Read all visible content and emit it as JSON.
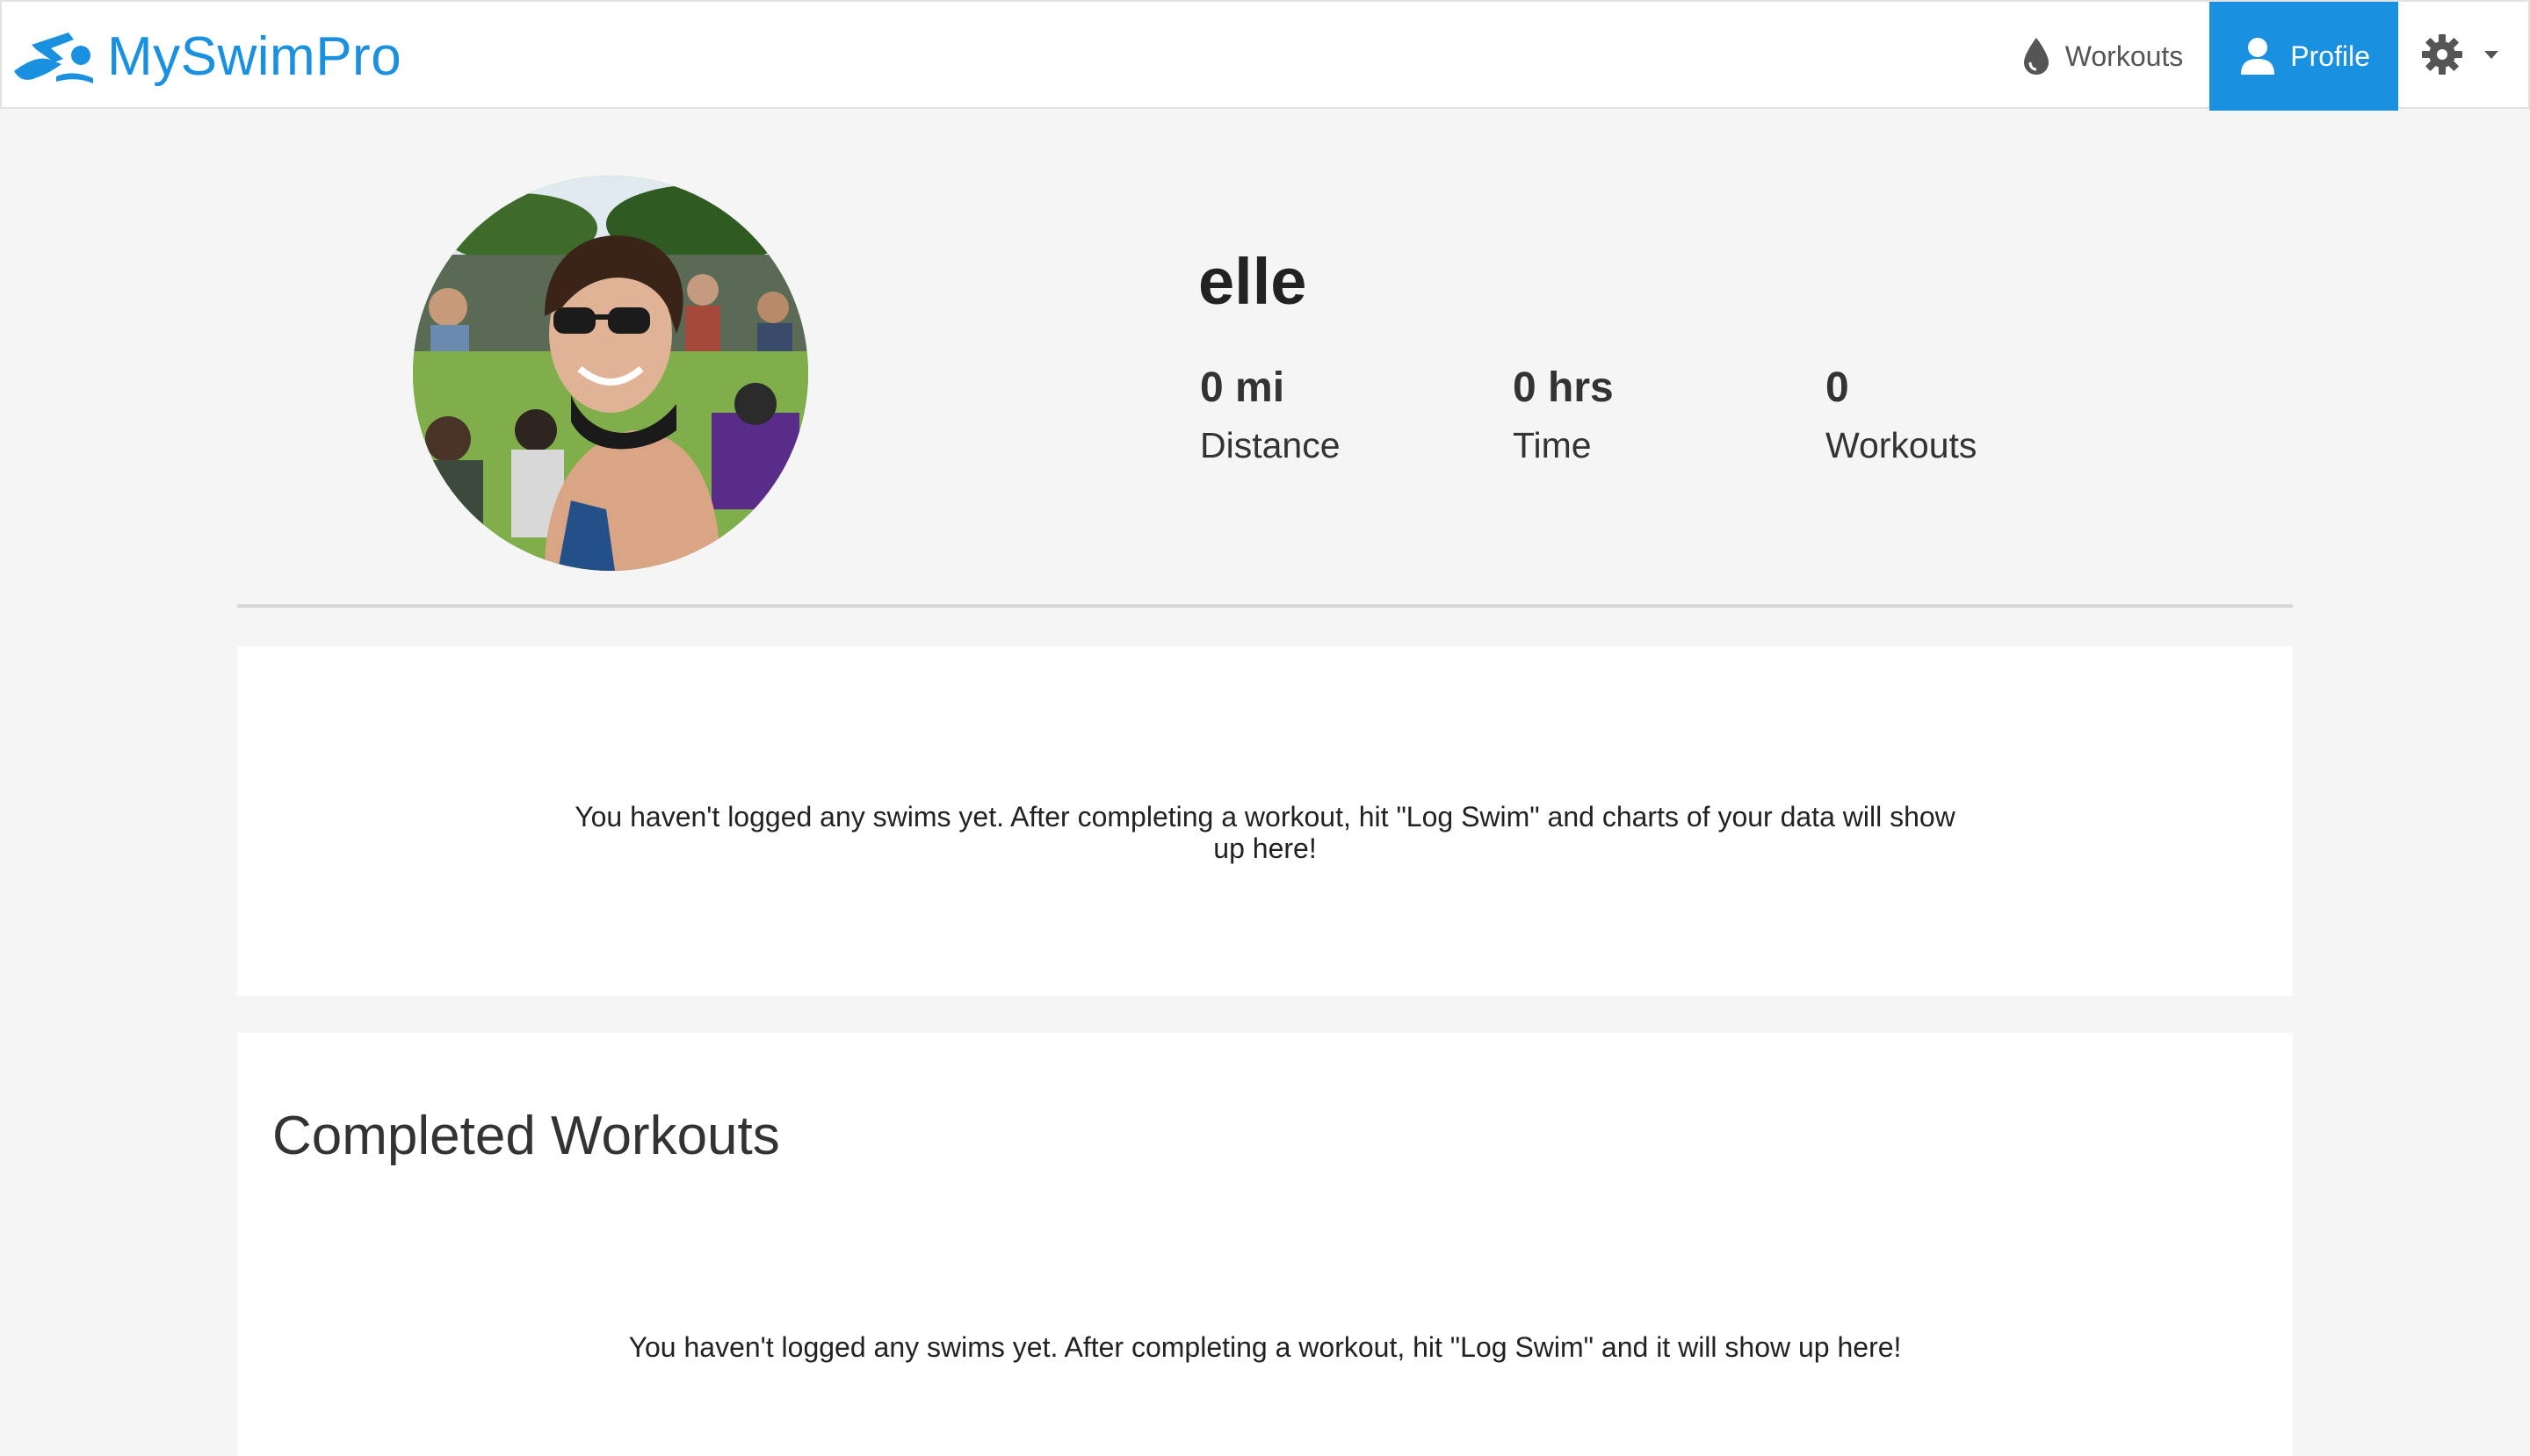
{
  "brand": {
    "name": "MySwimPro",
    "color": "#1a90e0"
  },
  "nav": {
    "workouts_label": "Workouts",
    "profile_label": "Profile",
    "workouts_icon": "drop-icon",
    "profile_icon": "user-icon",
    "settings_icon": "gear-icon",
    "active_color": "#1a90e0"
  },
  "profile": {
    "username": "elle",
    "avatar_icon": "profile-photo",
    "stats": [
      {
        "value": "0 mi",
        "label": "Distance"
      },
      {
        "value": "0 hrs",
        "label": "Time"
      },
      {
        "value": "0",
        "label": "Workouts"
      }
    ]
  },
  "charts_card": {
    "empty_message": "You haven't logged any swims yet. After completing a workout, hit \"Log Swim\" and charts of your data will show up here!"
  },
  "completed_card": {
    "title": "Completed Workouts",
    "empty_message": "You haven't logged any swims yet. After completing a workout, hit \"Log Swim\" and it will show up here!"
  }
}
